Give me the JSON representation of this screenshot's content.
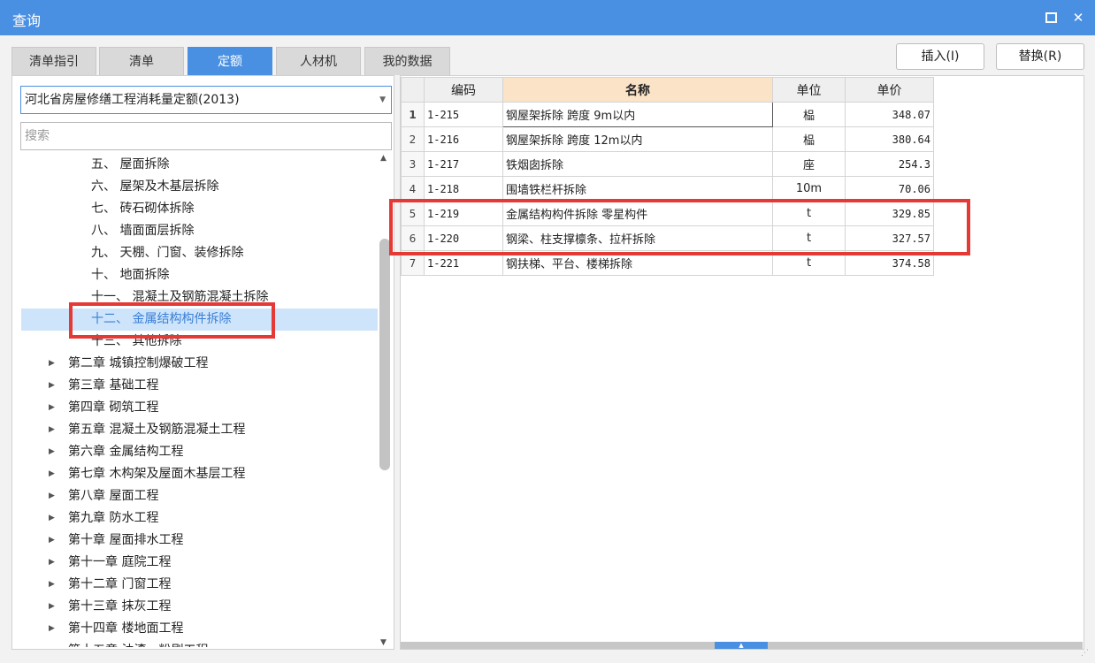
{
  "window": {
    "title": "查询",
    "restore_label": "□",
    "close_label": "✕"
  },
  "tabs": [
    {
      "label": "清单指引"
    },
    {
      "label": "清单"
    },
    {
      "label": "定额"
    },
    {
      "label": "人材机"
    },
    {
      "label": "我的数据"
    }
  ],
  "active_tab": "定额",
  "actions": {
    "insert_label": "插入(I)",
    "replace_label": "替换(R)"
  },
  "left": {
    "quota_library": "河北省房屋修缮工程消耗量定额(2013)",
    "search_placeholder": "搜索",
    "tree": [
      {
        "label": "五、 屋面拆除",
        "level": 2
      },
      {
        "label": "六、 屋架及木基层拆除",
        "level": 2
      },
      {
        "label": "七、 砖石砌体拆除",
        "level": 2
      },
      {
        "label": "八、 墙面面层拆除",
        "level": 2
      },
      {
        "label": "九、 天棚、门窗、装修拆除",
        "level": 2
      },
      {
        "label": "十、 地面拆除",
        "level": 2
      },
      {
        "label": "十一、 混凝土及钢筋混凝土拆除",
        "level": 2
      },
      {
        "label": "十二、 金属结构构件拆除",
        "level": 2,
        "selected": true
      },
      {
        "label": "十三、 其他拆除",
        "level": 2
      },
      {
        "label": "第二章 城镇控制爆破工程",
        "level": 1
      },
      {
        "label": "第三章 基础工程",
        "level": 1
      },
      {
        "label": "第四章 砌筑工程",
        "level": 1
      },
      {
        "label": "第五章 混凝土及钢筋混凝土工程",
        "level": 1
      },
      {
        "label": "第六章 金属结构工程",
        "level": 1
      },
      {
        "label": "第七章 木构架及屋面木基层工程",
        "level": 1
      },
      {
        "label": "第八章 屋面工程",
        "level": 1
      },
      {
        "label": "第九章 防水工程",
        "level": 1
      },
      {
        "label": "第十章 屋面排水工程",
        "level": 1
      },
      {
        "label": "第十一章 庭院工程",
        "level": 1
      },
      {
        "label": "第十二章 门窗工程",
        "level": 1
      },
      {
        "label": "第十三章 抹灰工程",
        "level": 1
      },
      {
        "label": "第十四章 楼地面工程",
        "level": 1
      },
      {
        "label": "第十五章 油漆、粉刷工程",
        "level": 1
      }
    ]
  },
  "grid": {
    "headers": {
      "code": "编码",
      "name": "名称",
      "unit": "单位",
      "price": "单价"
    },
    "rows": [
      {
        "index": "1",
        "code": "1-215",
        "name": "钢屋架拆除 跨度 9m以内",
        "unit": "榀",
        "price": "348.07"
      },
      {
        "index": "2",
        "code": "1-216",
        "name": "钢屋架拆除 跨度 12m以内",
        "unit": "榀",
        "price": "380.64"
      },
      {
        "index": "3",
        "code": "1-217",
        "name": "铁烟囱拆除",
        "unit": "座",
        "price": "254.3"
      },
      {
        "index": "4",
        "code": "1-218",
        "name": "围墙铁栏杆拆除",
        "unit": "10m",
        "price": "70.06"
      },
      {
        "index": "5",
        "code": "1-219",
        "name": "金属结构构件拆除 零星构件",
        "unit": "t",
        "price": "329.85"
      },
      {
        "index": "6",
        "code": "1-220",
        "name": "钢梁、柱支撑檩条、拉杆拆除",
        "unit": "t",
        "price": "327.57"
      },
      {
        "index": "7",
        "code": "1-221",
        "name": "钢扶梯、平台、楼梯拆除",
        "unit": "t",
        "price": "374.58"
      }
    ]
  },
  "colors": {
    "title_bar": "#4a90e2",
    "highlight_box": "#e53935",
    "selected_row": "#cde4fb",
    "name_header": "#fbe3c8"
  }
}
